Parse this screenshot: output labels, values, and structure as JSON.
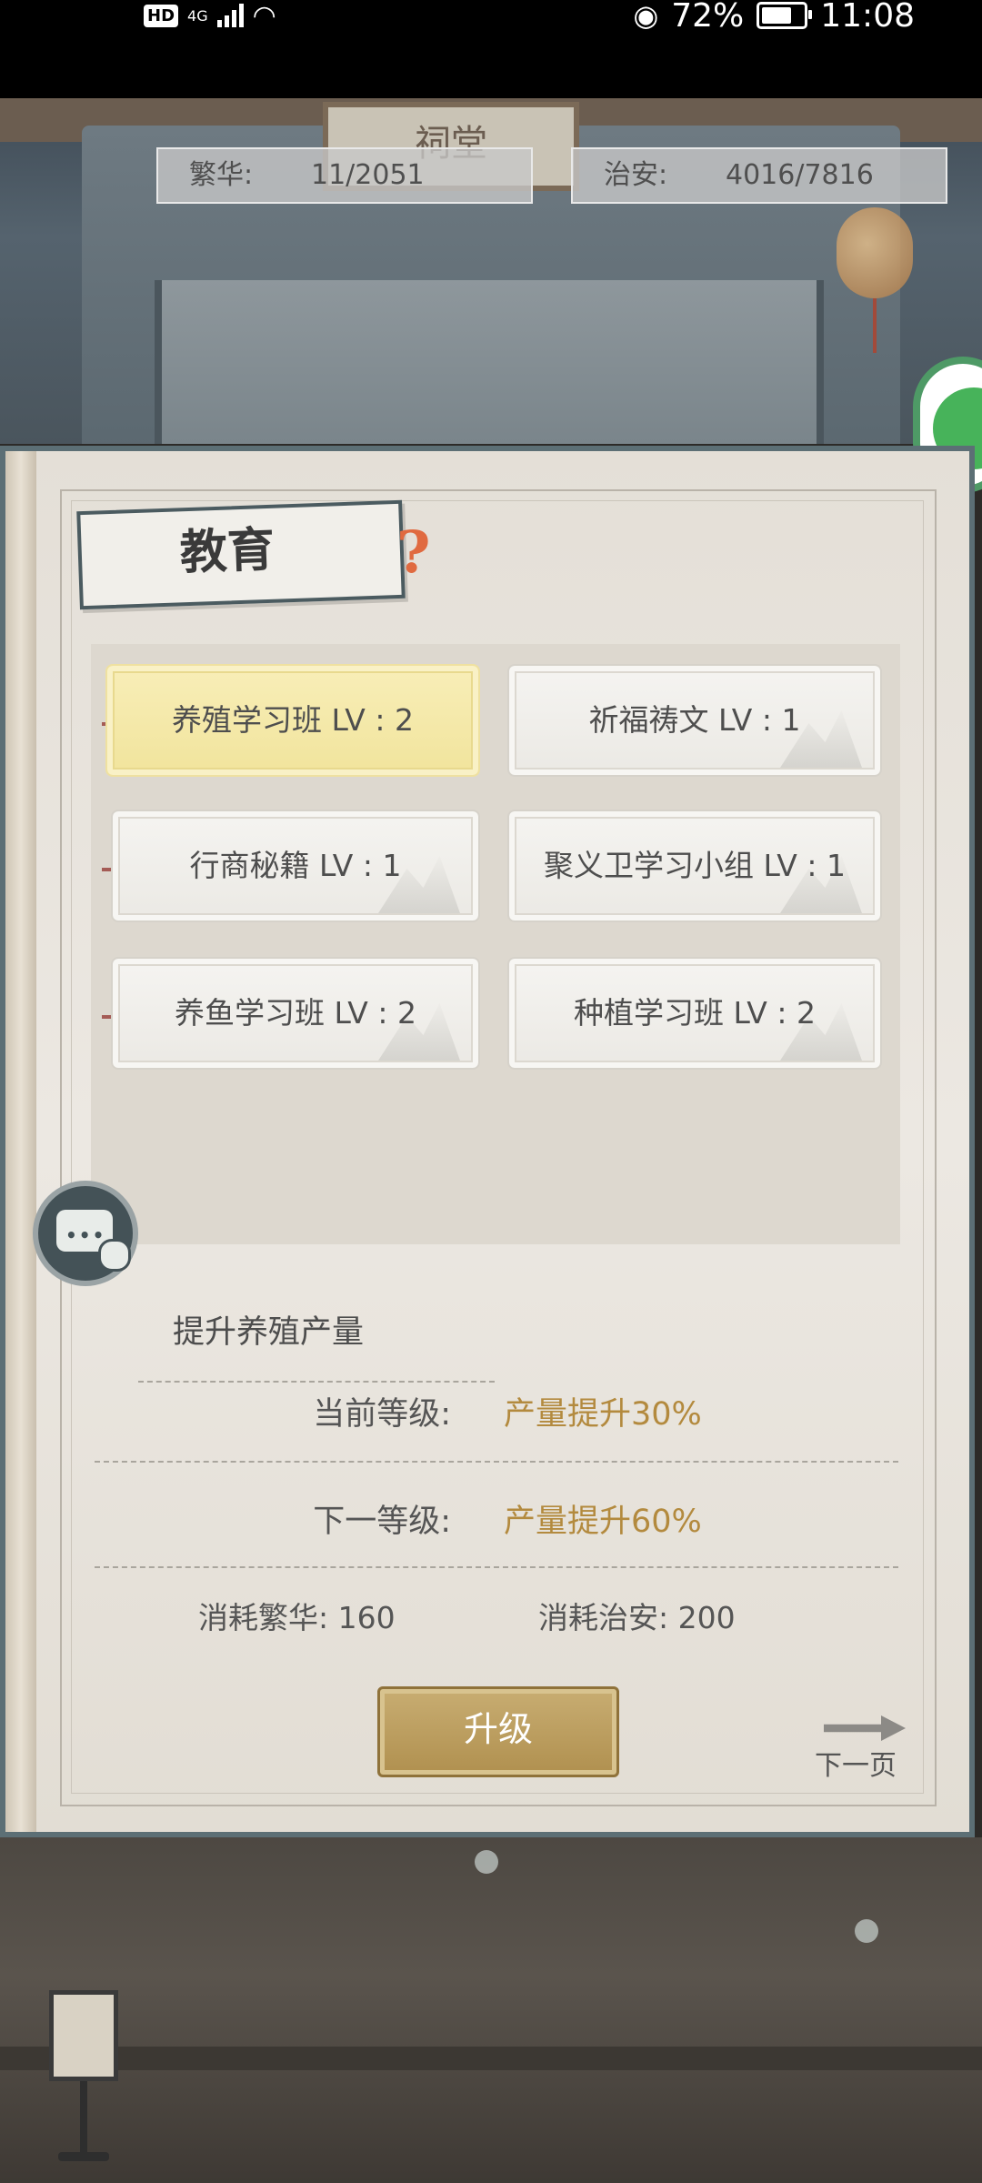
{
  "status_bar": {
    "hd": "HD",
    "network": "4G",
    "battery": "72%",
    "battery_level": 0.72,
    "time": "11:08"
  },
  "scene": {
    "building_sign": "祠堂"
  },
  "stats": {
    "prosperity_label": "繁华:",
    "prosperity_value": "11/2051",
    "security_label": "治安:",
    "security_value": "4016/7816"
  },
  "panel": {
    "title": "教育",
    "help_icon": "?"
  },
  "skills": [
    {
      "label": "养殖学习班 LV : 2",
      "active": true
    },
    {
      "label": "祈福祷文 LV : 1",
      "active": false
    },
    {
      "label": "行商秘籍 LV : 1",
      "active": false
    },
    {
      "label": "聚义卫学习小组 LV : 1",
      "active": false
    },
    {
      "label": "养鱼学习班 LV : 2",
      "active": false
    },
    {
      "label": "种植学习班 LV : 2",
      "active": false
    }
  ],
  "detail": {
    "description": "提升养殖产量",
    "current_label": "当前等级:",
    "current_value": "产量提升30%",
    "next_label": "下一等级:",
    "next_value": "产量提升60%",
    "cost_prosperity_label": "消耗繁华:",
    "cost_prosperity_value": "160",
    "cost_security_label": "消耗治安:",
    "cost_security_value": "200"
  },
  "buttons": {
    "upgrade": "升级",
    "next_page": "下一页"
  },
  "colors": {
    "accent_gold": "#b38a3e",
    "active_card": "#f1e49c",
    "frame_teal": "#5c6f75"
  }
}
